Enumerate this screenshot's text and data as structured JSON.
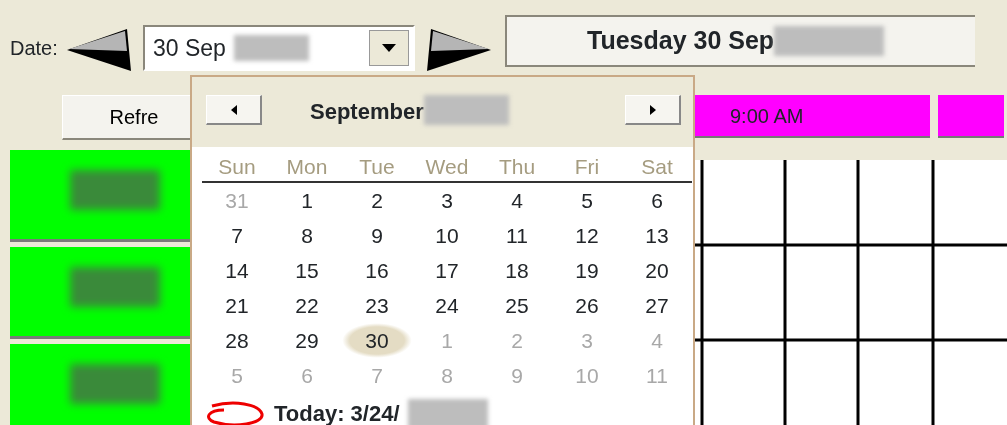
{
  "date_label": "Date:",
  "date_field": {
    "value": "30 Sep",
    "redacted": true
  },
  "day_header": {
    "text": "Tuesday 30 Sep",
    "redacted": true
  },
  "refresh_button": "Refre",
  "time_slots": [
    {
      "label": "9:00 AM",
      "cut_off": false
    },
    {
      "cut_off": true
    }
  ],
  "resource_rows": [
    {
      "redacted": true
    },
    {
      "redacted": true
    },
    {
      "redacted": true
    }
  ],
  "calendar": {
    "month": "September",
    "year_redacted": true,
    "weekdays": [
      "Sun",
      "Mon",
      "Tue",
      "Wed",
      "Thu",
      "Fri",
      "Sat"
    ],
    "weeks": [
      [
        {
          "day": "31",
          "in_month": false,
          "selected": false
        },
        {
          "day": "1",
          "in_month": true,
          "selected": false
        },
        {
          "day": "2",
          "in_month": true,
          "selected": false
        },
        {
          "day": "3",
          "in_month": true,
          "selected": false
        },
        {
          "day": "4",
          "in_month": true,
          "selected": false
        },
        {
          "day": "5",
          "in_month": true,
          "selected": false
        },
        {
          "day": "6",
          "in_month": true,
          "selected": false
        }
      ],
      [
        {
          "day": "7",
          "in_month": true,
          "selected": false
        },
        {
          "day": "8",
          "in_month": true,
          "selected": false
        },
        {
          "day": "9",
          "in_month": true,
          "selected": false
        },
        {
          "day": "10",
          "in_month": true,
          "selected": false
        },
        {
          "day": "11",
          "in_month": true,
          "selected": false
        },
        {
          "day": "12",
          "in_month": true,
          "selected": false
        },
        {
          "day": "13",
          "in_month": true,
          "selected": false
        }
      ],
      [
        {
          "day": "14",
          "in_month": true,
          "selected": false
        },
        {
          "day": "15",
          "in_month": true,
          "selected": false
        },
        {
          "day": "16",
          "in_month": true,
          "selected": false
        },
        {
          "day": "17",
          "in_month": true,
          "selected": false
        },
        {
          "day": "18",
          "in_month": true,
          "selected": false
        },
        {
          "day": "19",
          "in_month": true,
          "selected": false
        },
        {
          "day": "20",
          "in_month": true,
          "selected": false
        }
      ],
      [
        {
          "day": "21",
          "in_month": true,
          "selected": false
        },
        {
          "day": "22",
          "in_month": true,
          "selected": false
        },
        {
          "day": "23",
          "in_month": true,
          "selected": false
        },
        {
          "day": "24",
          "in_month": true,
          "selected": false
        },
        {
          "day": "25",
          "in_month": true,
          "selected": false
        },
        {
          "day": "26",
          "in_month": true,
          "selected": false
        },
        {
          "day": "27",
          "in_month": true,
          "selected": false
        }
      ],
      [
        {
          "day": "28",
          "in_month": true,
          "selected": false
        },
        {
          "day": "29",
          "in_month": true,
          "selected": false
        },
        {
          "day": "30",
          "in_month": true,
          "selected": true
        },
        {
          "day": "1",
          "in_month": false,
          "selected": false
        },
        {
          "day": "2",
          "in_month": false,
          "selected": false
        },
        {
          "day": "3",
          "in_month": false,
          "selected": false
        },
        {
          "day": "4",
          "in_month": false,
          "selected": false
        }
      ],
      [
        {
          "day": "5",
          "in_month": false,
          "selected": false
        },
        {
          "day": "6",
          "in_month": false,
          "selected": false
        },
        {
          "day": "7",
          "in_month": false,
          "selected": false
        },
        {
          "day": "8",
          "in_month": false,
          "selected": false
        },
        {
          "day": "9",
          "in_month": false,
          "selected": false
        },
        {
          "day": "10",
          "in_month": false,
          "selected": false
        },
        {
          "day": "11",
          "in_month": false,
          "selected": false
        }
      ]
    ],
    "today": {
      "text": "Today: 3/24/",
      "redacted": true
    }
  }
}
